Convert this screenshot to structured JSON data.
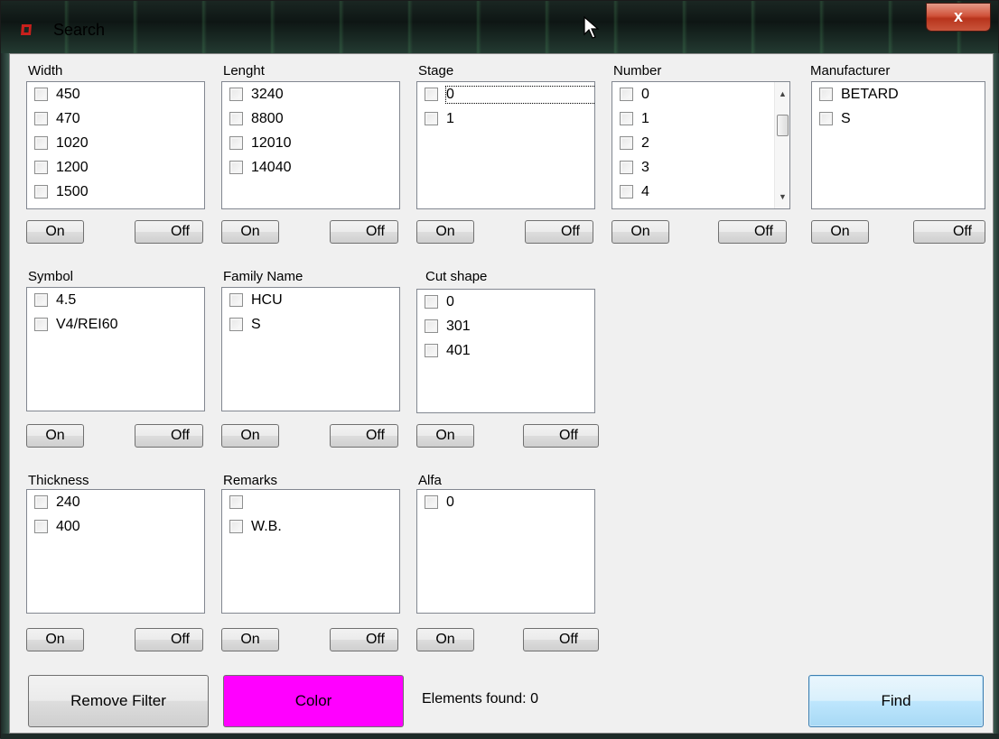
{
  "window": {
    "title": "Search",
    "close_label": "x"
  },
  "groups": {
    "width": {
      "label": "Width",
      "items": [
        "450",
        "470",
        "1020",
        "1200",
        "1500"
      ]
    },
    "length": {
      "label": "Lenght",
      "items": [
        "3240",
        "8800",
        "12010",
        "14040"
      ]
    },
    "stage": {
      "label": "Stage",
      "items": [
        "0",
        "1"
      ]
    },
    "number": {
      "label": "Number",
      "items": [
        "0",
        "1",
        "2",
        "3",
        "4"
      ]
    },
    "manufacturer": {
      "label": "Manufacturer",
      "items": [
        "BETARD",
        "S"
      ]
    },
    "symbol": {
      "label": "Symbol",
      "items": [
        "4.5",
        "V4/REI60"
      ]
    },
    "family": {
      "label": "Family Name",
      "items": [
        "HCU",
        "S"
      ]
    },
    "cut": {
      "label": "Cut shape",
      "items": [
        "0",
        "301",
        "401"
      ]
    },
    "thickness": {
      "label": "Thickness",
      "items": [
        "240",
        "400"
      ]
    },
    "remarks": {
      "label": "Remarks",
      "items": [
        "",
        "W.B."
      ]
    },
    "alfa": {
      "label": "Alfa",
      "items": [
        "0"
      ]
    }
  },
  "buttons": {
    "on": "On",
    "off": "Off",
    "remove_filter": "Remove Filter",
    "color": "Color",
    "find": "Find"
  },
  "status": {
    "elements_found": "Elements found: 0"
  },
  "colors": {
    "color_swatch": "#ff00ff",
    "find_border": "#3c7fb1",
    "app_icon": "#c8201c"
  }
}
